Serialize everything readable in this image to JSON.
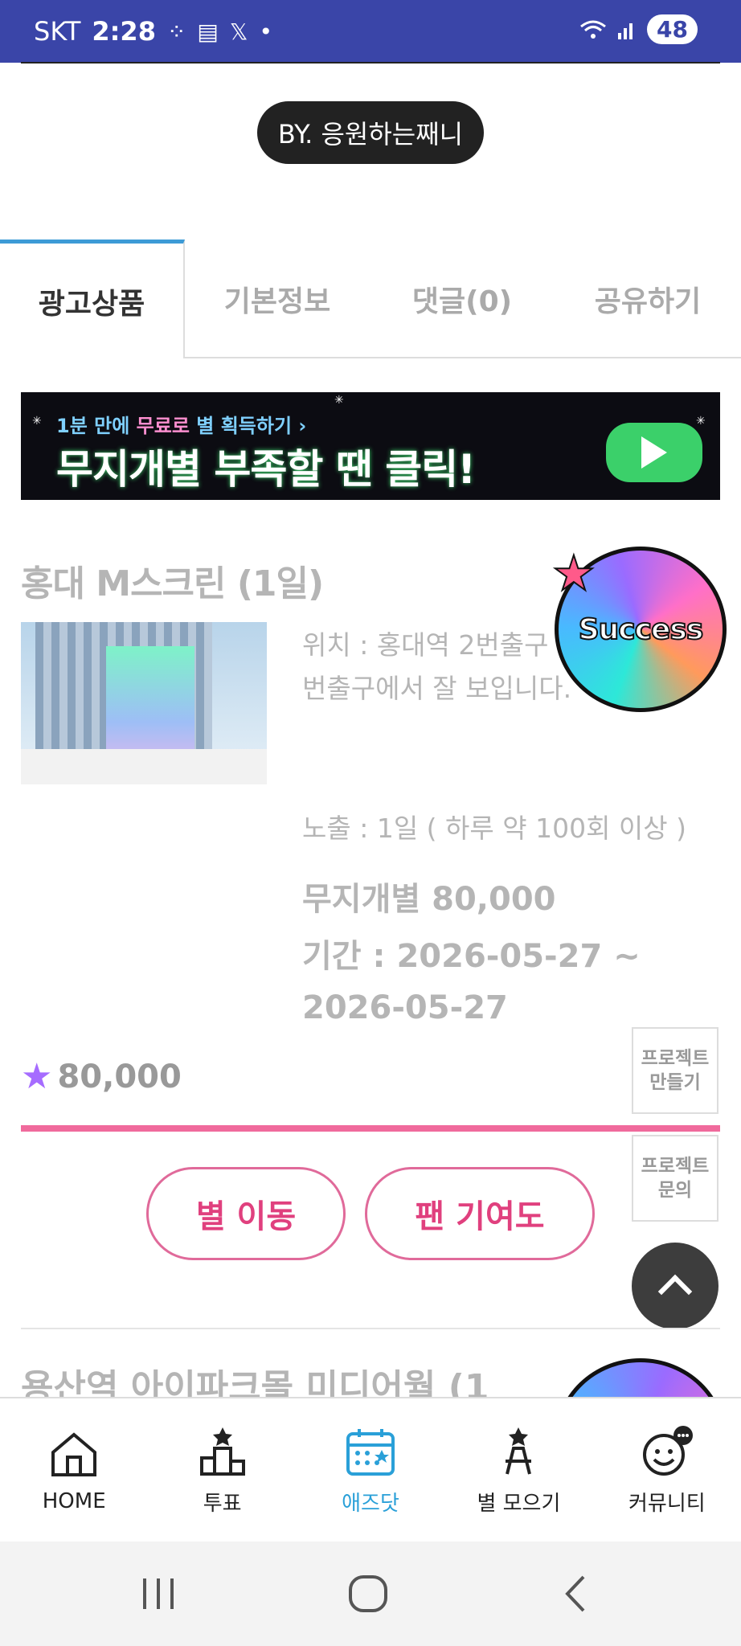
{
  "status_bar": {
    "carrier": "SKT",
    "time": "2:28",
    "notif_icons": [
      "grid-icon",
      "news-icon",
      "x-icon"
    ],
    "dot": "•",
    "battery": "48"
  },
  "author_badge": "BY. 응원하는째니",
  "tabs": [
    {
      "label": "광고상품",
      "active": true
    },
    {
      "label": "기본정보",
      "active": false
    },
    {
      "label": "댓글(0)",
      "active": false
    },
    {
      "label": "공유하기",
      "active": false
    }
  ],
  "banner": {
    "sub_prefix": "1분 만에",
    "sub_pink": "무료로",
    "sub_suffix": "별 획득하기 ›",
    "main": "무지개별 부족할 땐 클릭!"
  },
  "product": {
    "title": "홍대 M스크린 (1일)",
    "location": "위치 : 홍대역 2번출구 *홍대 8번, 9번출구에서 잘 보입니다.",
    "exposure": "노출 : 1일 ( 하루 약 100회 이상 )",
    "price_text": "무지개별 80,000",
    "period": "기간 : 2026-05-27 ~ 2026-05-27",
    "badge": "Success",
    "star_total": "80,000",
    "progress": 1.0
  },
  "side_buttons": {
    "make_project": "프로젝트 만들기",
    "ask_project": "프로젝트 문의"
  },
  "actions": {
    "star_move": "별 이동",
    "fan_contribution": "팬 기여도"
  },
  "next_product": {
    "title": "용산역 아이파크몰 미디어월 (1"
  },
  "bottom_nav": [
    {
      "label": "HOME",
      "icon": "home-icon",
      "active": false
    },
    {
      "label": "투표",
      "icon": "vote-icon",
      "active": false
    },
    {
      "label": "애즈닷",
      "icon": "calendar-icon",
      "active": true
    },
    {
      "label": "별 모으기",
      "icon": "star-collect-icon",
      "active": false
    },
    {
      "label": "커뮤니티",
      "icon": "community-icon",
      "active": false
    }
  ],
  "colors": {
    "status_bar": "#3a45a8",
    "accent_pink": "#e0407e",
    "active_nav": "#2aa0d8",
    "tab_indicator": "#3d9bd6"
  }
}
